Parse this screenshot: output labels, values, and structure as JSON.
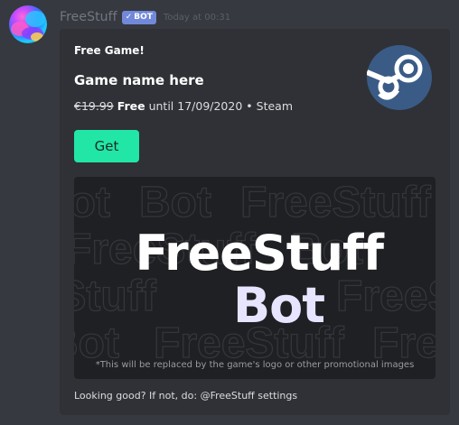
{
  "message": {
    "username": "FreeStuff",
    "bot_badge": "BOT",
    "bot_badge_check": "✓",
    "timestamp": "Today at 00:31"
  },
  "embed": {
    "author": "Free Game!",
    "title": "Game name here",
    "price_original": "€19.99",
    "price_free": "Free",
    "until_text": "until 17/09/2020",
    "separator": "•",
    "store": "Steam",
    "get_button_label": "Get",
    "thumbnail_icon": "steam-icon",
    "footer": "Looking good? If not, do: @FreeStuff settings"
  },
  "promo_image": {
    "title_line1": "FreeStuff",
    "title_line2": "Bot",
    "background_word_1": "FreeStuff",
    "background_word_2": "Bot",
    "caption": "*This will be replaced by the game's logo or other promotional images"
  },
  "colors": {
    "background": "#36393f",
    "embed_background": "#2f3136",
    "bot_badge": "#7289da",
    "get_button": "#21e6a6",
    "steam_circle": "#3a5b86",
    "promo_background": "#1f2023"
  }
}
